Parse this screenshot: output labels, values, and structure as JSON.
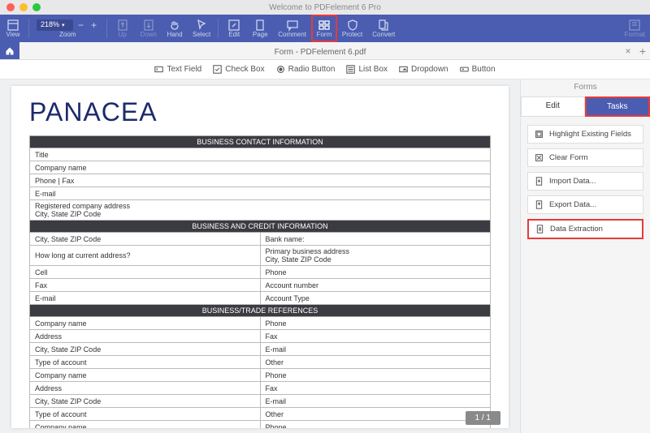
{
  "titlebar": {
    "app_title": "Welcome to PDFelement 6 Pro"
  },
  "toolbar": {
    "view": "View",
    "zoom": "Zoom",
    "zoom_value": "218%",
    "up": "Up",
    "down": "Down",
    "hand": "Hand",
    "select": "Select",
    "edit": "Edit",
    "page": "Page",
    "comment": "Comment",
    "form": "Form",
    "protect": "Protect",
    "convert": "Convert",
    "format": "Format"
  },
  "doc_tab": {
    "title": "Form - PDFelement 6.pdf"
  },
  "formtools": {
    "text_field": "Text Field",
    "check_box": "Check Box",
    "radio_button": "Radio Button",
    "list_box": "List Box",
    "dropdown": "Dropdown",
    "button": "Button"
  },
  "document": {
    "heading": "PANACEA",
    "sec1_header": "BUSINESS CONTACT INFORMATION",
    "sec1": {
      "r1": "Title",
      "r2": "Company name",
      "r3": "Phone | Fax",
      "r4": "E-mail",
      "r5a": "Registered company address",
      "r5b": "City, State ZIP Code"
    },
    "sec2_header": "BUSINESS AND CREDIT INFORMATION",
    "sec2": {
      "l1": "City, State ZIP Code",
      "r1": "Bank name:",
      "l2": "How long at current address?",
      "r2a": "Primary business address",
      "r2b": "City, State ZIP Code",
      "l3": "Cell",
      "r3": "Phone",
      "l4": "Fax",
      "r4": "Account number",
      "l5": "E-mail",
      "r5": "Account Type"
    },
    "sec3_header": "BUSINESS/TRADE REFERENCES",
    "sec3": {
      "l1": "Company name",
      "r1": "Phone",
      "l2": "Address",
      "r2": "Fax",
      "l3": "City, State ZIP Code",
      "r3": "E-mail",
      "l4": "Type of account",
      "r4": "Other",
      "l5": "Company name",
      "r5": "Phone",
      "l6": "Address",
      "r6": "Fax",
      "l7": "City, State ZIP Code",
      "r7": "E-mail",
      "l8": "Type of account",
      "r8": "Other",
      "l9": "Company name",
      "r9": "Phone"
    }
  },
  "page_indicator": "1 / 1",
  "rpanel": {
    "title": "Forms",
    "tab_edit": "Edit",
    "tab_tasks": "Tasks",
    "items": {
      "highlight": "Highlight Existing Fields",
      "clear": "Clear Form",
      "import": "Import Data...",
      "export": "Export Data...",
      "extract": "Data Extraction"
    }
  }
}
